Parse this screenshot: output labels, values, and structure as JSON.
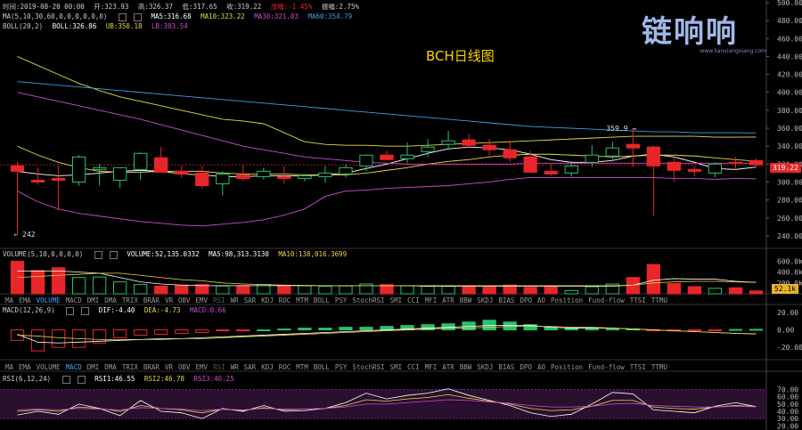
{
  "header": {
    "time_label": "时间:2019-08-20 00:00",
    "open_label": "开:323.93",
    "high_label": "高:326.37",
    "low_label": "低:317.65",
    "close_label": "收:319.22",
    "change_label": "涨幅:-1.45%",
    "amplitude_label": "振幅:2.75%"
  },
  "ma_line": {
    "params": "MA(5,10,30,60,0,0,0,0,0,0)",
    "ma5": "MA5:316.68",
    "ma10": "MA10:323.22",
    "ma30": "MA30:321.03",
    "ma60": "MA60:354.79"
  },
  "boll_line": {
    "params": "BOLL(20,2)",
    "boll": "BOLL:326.86",
    "ub": "UB:350.18",
    "lb": "LB:303.54"
  },
  "volume_line": {
    "params": "VOLUME(5,10,0,0,0,0)",
    "volume": "VOLUME:52,135.0332",
    "ma5": "MA5:98,313.3130",
    "ma10": "MA10:138,016.3699"
  },
  "macd_line": {
    "params": "MACD(12,26,9)",
    "dif": "DIF:-4.40",
    "dea": "DEA:-4.73",
    "macd": "MACD:0.66"
  },
  "rsi_line": {
    "params": "RSI(6,12,24)",
    "rsi1": "RSI1:46.55",
    "rsi2": "RSI2:46.78",
    "rsi3": "RSI3:46.25"
  },
  "indicator_tabs": [
    "MA",
    "EMA",
    "VOLUME",
    "MACD",
    "DMI",
    "DMA",
    "TRIX",
    "BRAR",
    "VR",
    "OBV",
    "EMV",
    "RSI",
    "WR",
    "SAR",
    "KDJ",
    "ROC",
    "MTM",
    "BOLL",
    "PSY",
    "StochRSI",
    "SMI",
    "CCI",
    "MFI",
    "ATR",
    "BBW",
    "SKDJ",
    "BIAS",
    "DPO",
    "AO",
    "Position",
    "Fund-flow",
    "TTSI",
    "TTMU"
  ],
  "volume_tabs_active": "VOLUME",
  "macd_tabs_active": "MACD",
  "dim_tab": "RSI",
  "logo": {
    "text": "链响响",
    "url": "www.lianxiangxiang.com"
  },
  "colors": {
    "up": "#26c26e",
    "down": "#e8262a",
    "ma5": "#ffffff",
    "ma10": "#e6d84a",
    "ma30": "#d04bd0",
    "ma60": "#3aa0e6",
    "bg": "#000000",
    "last_price_bg": "#e8262a",
    "volume_tag_bg": "#e8b32a"
  },
  "chart_data": {
    "title": "BCH日线图",
    "type": "candlestick",
    "price_axis": {
      "ticks": [
        500,
        480,
        460,
        440,
        420,
        400,
        380,
        360,
        340,
        320,
        300,
        280,
        260,
        240
      ],
      "ylim": [
        227,
        503
      ]
    },
    "last_price": "319.22",
    "annotations": {
      "high_marker": "359.9 →",
      "low_marker": "← 242"
    },
    "candles": [
      {
        "o": 318,
        "h": 323,
        "l": 242,
        "c": 312
      },
      {
        "o": 302,
        "h": 316,
        "l": 297,
        "c": 300
      },
      {
        "o": 304,
        "h": 318,
        "l": 268,
        "c": 302
      },
      {
        "o": 300,
        "h": 330,
        "l": 296,
        "c": 328
      },
      {
        "o": 314,
        "h": 320,
        "l": 296,
        "c": 316
      },
      {
        "o": 302,
        "h": 314,
        "l": 293,
        "c": 316
      },
      {
        "o": 314,
        "h": 333,
        "l": 302,
        "c": 332
      },
      {
        "o": 327,
        "h": 339,
        "l": 312,
        "c": 311
      },
      {
        "o": 312,
        "h": 318,
        "l": 305,
        "c": 309
      },
      {
        "o": 310,
        "h": 318,
        "l": 293,
        "c": 296
      },
      {
        "o": 298,
        "h": 312,
        "l": 285,
        "c": 309
      },
      {
        "o": 308,
        "h": 319,
        "l": 301,
        "c": 304
      },
      {
        "o": 306,
        "h": 316,
        "l": 303,
        "c": 312
      },
      {
        "o": 306,
        "h": 318,
        "l": 298,
        "c": 304
      },
      {
        "o": 304,
        "h": 308,
        "l": 301,
        "c": 307
      },
      {
        "o": 306,
        "h": 318,
        "l": 299,
        "c": 310
      },
      {
        "o": 309,
        "h": 320,
        "l": 305,
        "c": 316
      },
      {
        "o": 318,
        "h": 331,
        "l": 312,
        "c": 330
      },
      {
        "o": 330,
        "h": 335,
        "l": 324,
        "c": 325
      },
      {
        "o": 326,
        "h": 344,
        "l": 321,
        "c": 330
      },
      {
        "o": 334,
        "h": 348,
        "l": 328,
        "c": 339
      },
      {
        "o": 342,
        "h": 357,
        "l": 336,
        "c": 346
      },
      {
        "o": 347,
        "h": 354,
        "l": 338,
        "c": 341
      },
      {
        "o": 341,
        "h": 348,
        "l": 330,
        "c": 336
      },
      {
        "o": 336,
        "h": 346,
        "l": 323,
        "c": 327
      },
      {
        "o": 328,
        "h": 335,
        "l": 312,
        "c": 311
      },
      {
        "o": 312,
        "h": 320,
        "l": 307,
        "c": 309
      },
      {
        "o": 310,
        "h": 323,
        "l": 306,
        "c": 318
      },
      {
        "o": 322,
        "h": 341,
        "l": 317,
        "c": 330
      },
      {
        "o": 329,
        "h": 345,
        "l": 323,
        "c": 338
      },
      {
        "o": 342,
        "h": 360,
        "l": 317,
        "c": 338
      },
      {
        "o": 339,
        "h": 341,
        "l": 262,
        "c": 318
      },
      {
        "o": 322,
        "h": 326,
        "l": 300,
        "c": 313
      },
      {
        "o": 314,
        "h": 318,
        "l": 306,
        "c": 312
      },
      {
        "o": 310,
        "h": 322,
        "l": 305,
        "c": 320
      },
      {
        "o": 322,
        "h": 328,
        "l": 314,
        "c": 321
      },
      {
        "o": 323.93,
        "h": 326.37,
        "l": 317.65,
        "c": 319.22
      }
    ],
    "series": [
      {
        "name": "MA5",
        "values": [
          312,
          309,
          307,
          308,
          310,
          312,
          313,
          312,
          309,
          308,
          306,
          306,
          307,
          307,
          307,
          308,
          310,
          315,
          320,
          326,
          332,
          337,
          339,
          338,
          336,
          331,
          325,
          322,
          322,
          324,
          329,
          331,
          328,
          322,
          315,
          314,
          316.68
        ]
      },
      {
        "name": "MA10",
        "values": [
          340,
          330,
          322,
          316,
          312,
          311,
          311,
          312,
          312,
          312,
          310,
          309,
          309,
          309,
          308,
          308,
          308,
          310,
          313,
          316,
          320,
          323,
          325,
          328,
          330,
          331,
          331,
          330,
          329,
          328,
          329,
          330,
          330,
          329,
          327,
          325,
          323.22
        ]
      },
      {
        "name": "UB",
        "values": [
          440,
          430,
          420,
          410,
          402,
          395,
          390,
          385,
          380,
          375,
          370,
          368,
          365,
          355,
          345,
          342,
          341,
          341,
          340,
          340,
          341,
          342,
          343,
          344,
          345,
          346,
          347,
          348,
          349,
          350,
          351,
          351,
          351,
          351,
          350,
          350,
          350.18
        ]
      },
      {
        "name": "LB",
        "values": [
          290,
          278,
          270,
          265,
          262,
          259,
          256,
          254,
          252,
          251,
          253,
          255,
          258,
          263,
          270,
          284,
          290,
          291,
          293,
          294,
          295,
          296,
          298,
          300,
          303,
          305,
          305,
          305,
          305,
          305,
          305,
          305,
          304,
          304,
          303,
          304,
          303.54
        ]
      },
      {
        "name": "MA60",
        "values": [
          412,
          410,
          408,
          406,
          404,
          402,
          400,
          398,
          396,
          394,
          392,
          390,
          388,
          386,
          384,
          382,
          380,
          378,
          376,
          374,
          372,
          370,
          368,
          366,
          364,
          362,
          361,
          360,
          359,
          358,
          357,
          356,
          356,
          355,
          355,
          355,
          354.79
        ]
      },
      {
        "name": "MA30",
        "values": [
          400,
          395,
          390,
          385,
          380,
          375,
          370,
          364,
          358,
          352,
          346,
          340,
          336,
          332,
          328,
          326,
          324,
          322,
          321,
          320,
          320,
          320,
          320,
          320,
          320,
          321,
          321,
          321,
          321,
          321,
          321,
          321,
          321,
          321,
          321,
          321,
          321.03
        ]
      }
    ],
    "volume_axis": {
      "ticks": [
        "600.0k",
        "400.0k",
        "200.0k"
      ],
      "ymax": 640,
      "last_label": "52.1k"
    },
    "volume": [
      600,
      430,
      480,
      300,
      310,
      220,
      170,
      140,
      160,
      170,
      145,
      150,
      170,
      150,
      150,
      140,
      145,
      180,
      170,
      150,
      140,
      140,
      145,
      130,
      160,
      120,
      140,
      60,
      130,
      180,
      300,
      540,
      190,
      130,
      100,
      110,
      52.1
    ],
    "volume_ma": [
      {
        "name": "MA5",
        "values": [
          420,
          420,
          420,
          400,
          380,
          300,
          220,
          180,
          160,
          150,
          150,
          150,
          150,
          150,
          150,
          150,
          150,
          150,
          150,
          150,
          140,
          140,
          140,
          140,
          140,
          140,
          140,
          140,
          140,
          140,
          160,
          250,
          280,
          270,
          270,
          230,
          210
        ]
      },
      {
        "name": "MA10",
        "values": [
          300,
          320,
          340,
          360,
          380,
          380,
          340,
          300,
          260,
          240,
          200,
          180,
          170,
          160,
          155,
          150,
          150,
          150,
          150,
          150,
          150,
          150,
          150,
          150,
          150,
          150,
          150,
          150,
          150,
          150,
          160,
          200,
          220,
          230,
          230,
          220,
          210
        ]
      }
    ],
    "macd_axis": {
      "ticks": [
        "20.00",
        "0.00",
        "-20.00"
      ],
      "ylim": [
        -30,
        25
      ]
    },
    "macd": [
      {
        "hist": -12,
        "dif": -5,
        "dea": -6
      },
      {
        "hist": -24,
        "dif": -14,
        "dea": -7
      },
      {
        "hist": -20,
        "dif": -15,
        "dea": -9
      },
      {
        "hist": -20,
        "dif": -14,
        "dea": -10
      },
      {
        "hist": -15,
        "dif": -13,
        "dea": -11
      },
      {
        "hist": -9,
        "dif": -12,
        "dea": -11
      },
      {
        "hist": -6,
        "dif": -11,
        "dea": -11
      },
      {
        "hist": -5,
        "dif": -10,
        "dea": -11
      },
      {
        "hist": -4,
        "dif": -10,
        "dea": -10
      },
      {
        "hist": -3,
        "dif": -9,
        "dea": -10
      },
      {
        "hist": -1,
        "dif": -8,
        "dea": -9
      },
      {
        "hist": -1,
        "dif": -7,
        "dea": -8
      },
      {
        "hist": 0,
        "dif": -6,
        "dea": -7
      },
      {
        "hist": 1,
        "dif": -5,
        "dea": -6
      },
      {
        "hist": 2,
        "dif": -4,
        "dea": -5
      },
      {
        "hist": 2,
        "dif": -3,
        "dea": -4
      },
      {
        "hist": 3,
        "dif": -2,
        "dea": -3
      },
      {
        "hist": 3,
        "dif": -1,
        "dea": -2
      },
      {
        "hist": 4,
        "dif": 0,
        "dea": -1
      },
      {
        "hist": 5,
        "dif": 1,
        "dea": 0
      },
      {
        "hist": 6,
        "dif": 2,
        "dea": 1
      },
      {
        "hist": 7,
        "dif": 3,
        "dea": 2
      },
      {
        "hist": 9,
        "dif": 4,
        "dea": 2
      },
      {
        "hist": 11,
        "dif": 5,
        "dea": 3
      },
      {
        "hist": 9,
        "dif": 5,
        "dea": 4
      },
      {
        "hist": 6,
        "dif": 5,
        "dea": 4
      },
      {
        "hist": 3,
        "dif": 3,
        "dea": 4
      },
      {
        "hist": 2,
        "dif": 2,
        "dea": 3
      },
      {
        "hist": 1,
        "dif": 2,
        "dea": 3
      },
      {
        "hist": 1,
        "dif": 2,
        "dea": 2
      },
      {
        "hist": 1,
        "dif": 1,
        "dea": 1
      },
      {
        "hist": -1,
        "dif": 0,
        "dea": 0
      },
      {
        "hist": -1,
        "dif": -1,
        "dea": -1
      },
      {
        "hist": -1,
        "dif": -2,
        "dea": -2
      },
      {
        "hist": -1,
        "dif": -3,
        "dea": -3
      },
      {
        "hist": 0.5,
        "dif": -4,
        "dea": -4
      },
      {
        "hist": 0.66,
        "dif": -4.4,
        "dea": -4.73
      }
    ],
    "rsi_axis": {
      "ticks": [
        "70.00",
        "60.00",
        "50.00",
        "40.00",
        "30.00",
        "20.00"
      ],
      "ylim": [
        18,
        78
      ],
      "band": [
        30,
        70
      ]
    },
    "rsi": [
      {
        "name": "RSI1",
        "values": [
          35,
          40,
          36,
          50,
          44,
          34,
          55,
          40,
          38,
          30,
          44,
          40,
          48,
          40,
          41,
          44,
          52,
          65,
          57,
          62,
          65,
          71,
          62,
          55,
          48,
          38,
          33,
          36,
          50,
          66,
          64,
          42,
          40,
          38,
          47,
          52,
          46.55
        ]
      },
      {
        "name": "RSI2",
        "values": [
          40,
          42,
          40,
          46,
          44,
          40,
          48,
          44,
          42,
          38,
          43,
          41,
          45,
          42,
          43,
          44,
          48,
          56,
          54,
          57,
          59,
          63,
          58,
          54,
          50,
          44,
          41,
          42,
          47,
          55,
          55,
          46,
          44,
          43,
          46,
          48,
          46.78
        ]
      },
      {
        "name": "RSI3",
        "values": [
          42,
          43,
          42,
          44,
          43,
          42,
          45,
          44,
          43,
          41,
          43,
          42,
          44,
          43,
          43,
          44,
          46,
          50,
          50,
          52,
          54,
          56,
          55,
          53,
          51,
          48,
          46,
          46,
          47,
          50,
          51,
          48,
          47,
          46,
          46,
          47,
          46.25
        ]
      }
    ]
  }
}
